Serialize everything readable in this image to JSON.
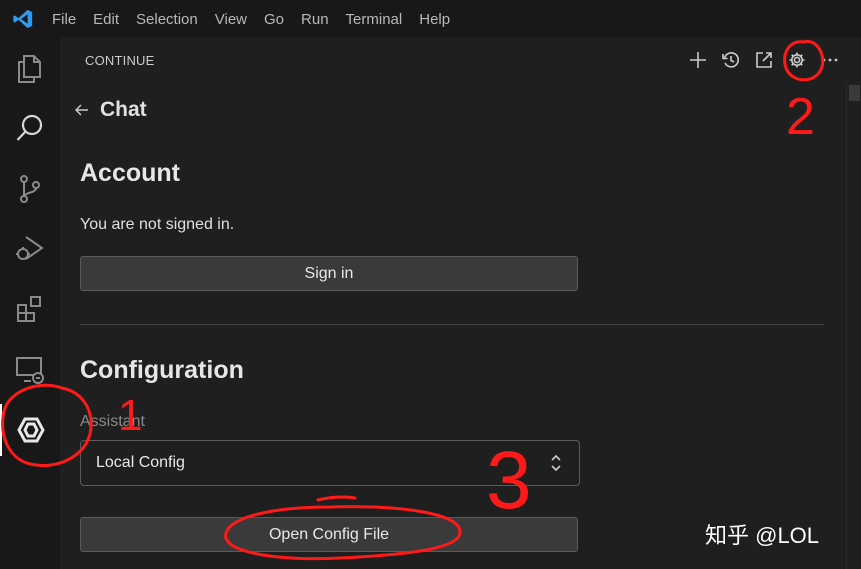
{
  "menu": [
    "File",
    "Edit",
    "Selection",
    "View",
    "Go",
    "Run",
    "Terminal",
    "Help"
  ],
  "activity_bar": [
    "explorer-icon",
    "search-icon",
    "source-control-icon",
    "run-debug-icon",
    "extensions-icon",
    "remote-explorer-icon",
    "continue-icon"
  ],
  "panel": {
    "title": "CONTINUE",
    "actions": [
      "plus-icon",
      "history-icon",
      "open-external-icon",
      "gear-icon",
      "more-icon"
    ]
  },
  "back": {
    "label": "Chat"
  },
  "account": {
    "heading": "Account",
    "status": "You are not signed in.",
    "sign_in": "Sign in"
  },
  "configuration": {
    "heading": "Configuration",
    "assistant_label": "Assistant",
    "assistant_value": "Local Config",
    "open_config": "Open Config File"
  },
  "annotations": [
    "1",
    "2",
    "3"
  ],
  "watermark": "知乎 @LOL",
  "colors": {
    "annotation": "#ff1a1a",
    "accent": "#2f9bf0"
  }
}
